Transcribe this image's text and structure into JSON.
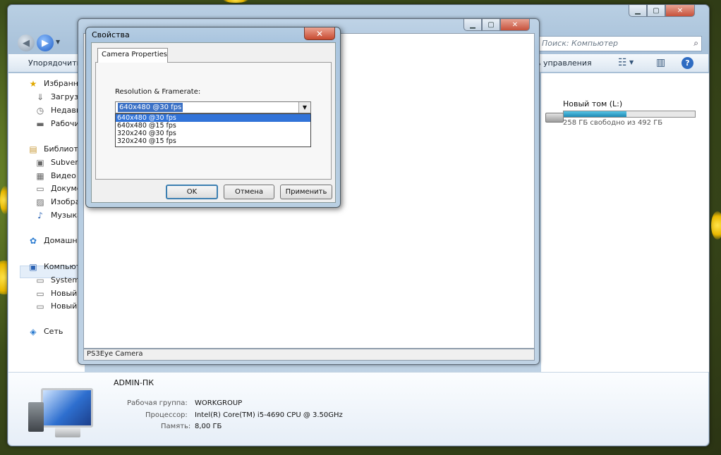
{
  "explorer": {
    "search_placeholder": "Поиск: Компьютер",
    "toolbar": {
      "organize": "Упорядочить",
      "control_panel": "ь управления"
    },
    "nav_items": [
      {
        "label": "Избранное",
        "icon": "star-icon"
      },
      {
        "label": "Загрузки",
        "icon": "downloads-icon"
      },
      {
        "label": "Недавние места",
        "icon": "recent-places-icon"
      },
      {
        "label": "Рабочий стол",
        "icon": "desktop-icon"
      },
      {
        "label": "Библиотеки",
        "icon": "libraries-icon"
      },
      {
        "label": "Subversion",
        "icon": "subversion-icon"
      },
      {
        "label": "Видео",
        "icon": "video-icon"
      },
      {
        "label": "Документы",
        "icon": "documents-icon"
      },
      {
        "label": "Изображения",
        "icon": "pictures-icon"
      },
      {
        "label": "Музыка",
        "icon": "music-icon"
      },
      {
        "label": "Домашняя группа",
        "icon": "homegroup-icon"
      },
      {
        "label": "Компьютер",
        "icon": "computer-icon"
      },
      {
        "label": "System (C:)",
        "icon": "drive-icon"
      },
      {
        "label": "Новый том (D:)",
        "icon": "drive-icon"
      },
      {
        "label": "Новый том (L:)",
        "icon": "drive-icon"
      },
      {
        "label": "Сеть",
        "icon": "network-icon"
      }
    ],
    "drive": {
      "name": "Новый том (L:)",
      "free_text": "258 ГБ свободно из 492 ГБ",
      "used_fraction": 0.48
    },
    "details": {
      "computer_name": "ADMIN-ПК",
      "workgroup_label": "Рабочая группа:",
      "workgroup_value": "WORKGROUP",
      "cpu_label": "Процессор:",
      "cpu_value": "Intel(R) Core(TM) i5-4690 CPU @ 3.50GHz",
      "memory_label": "Память:",
      "memory_value": "8,00 ГБ"
    }
  },
  "inner_window": {
    "status_text": "PS3Eye Camera"
  },
  "dialog": {
    "title": "Свойства",
    "tab_label": "Camera Properties",
    "resolution_label": "Resolution & Framerate:",
    "selected_value": "640x480 @30 fps",
    "options": [
      "640x480 @30 fps",
      "640x480 @15 fps",
      "320x240 @30 fps",
      "320x240 @15 fps"
    ],
    "ok_label": "OK",
    "cancel_label": "Отмена",
    "apply_label": "Применить"
  },
  "colors": {
    "selection": "#3173d8",
    "drive_bar": "#2fa3c8"
  }
}
